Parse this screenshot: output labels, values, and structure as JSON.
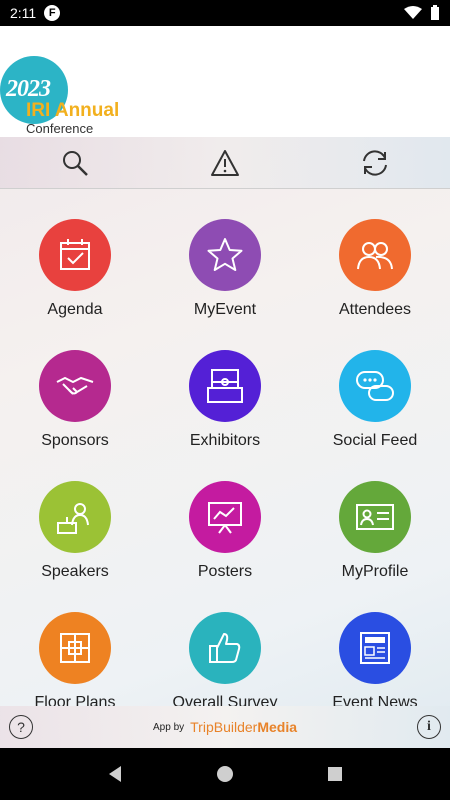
{
  "status_bar": {
    "time": "2:11",
    "notification": "F"
  },
  "header": {
    "logo_year": "2023",
    "logo_name": "IRI Annual",
    "logo_sub": "Conference"
  },
  "toolbar": {
    "search_icon": "search-icon",
    "alert_icon": "warning-icon",
    "refresh_icon": "refresh-icon"
  },
  "tiles": [
    {
      "label": "Agenda",
      "color": "#e8413e",
      "icon": "calendar-check-icon"
    },
    {
      "label": "MyEvent",
      "color": "#8e4cb3",
      "icon": "star-icon"
    },
    {
      "label": "Attendees",
      "color": "#f06a2f",
      "icon": "people-icon"
    },
    {
      "label": "Sponsors",
      "color": "#b5298f",
      "icon": "handshake-icon"
    },
    {
      "label": "Exhibitors",
      "color": "#5420d6",
      "icon": "booth-icon"
    },
    {
      "label": "Social Feed",
      "color": "#22b4ea",
      "icon": "chat-bubbles-icon"
    },
    {
      "label": "Speakers",
      "color": "#9bc235",
      "icon": "speaker-podium-icon"
    },
    {
      "label": "Posters",
      "color": "#c41ba0",
      "icon": "presentation-board-icon"
    },
    {
      "label": "MyProfile",
      "color": "#64a83a",
      "icon": "id-card-icon"
    },
    {
      "label": "Floor Plans",
      "color": "#ee8222",
      "icon": "floor-plan-icon"
    },
    {
      "label": "Overall Survey",
      "color": "#2ab3bd",
      "icon": "thumbs-up-icon"
    },
    {
      "label": "Event News",
      "color": "#2a4ee2",
      "icon": "newspaper-icon"
    }
  ],
  "footer": {
    "app_by": "App by",
    "brand_1": "TripBuilder",
    "brand_2": "Media",
    "help": "?",
    "info": "i"
  }
}
